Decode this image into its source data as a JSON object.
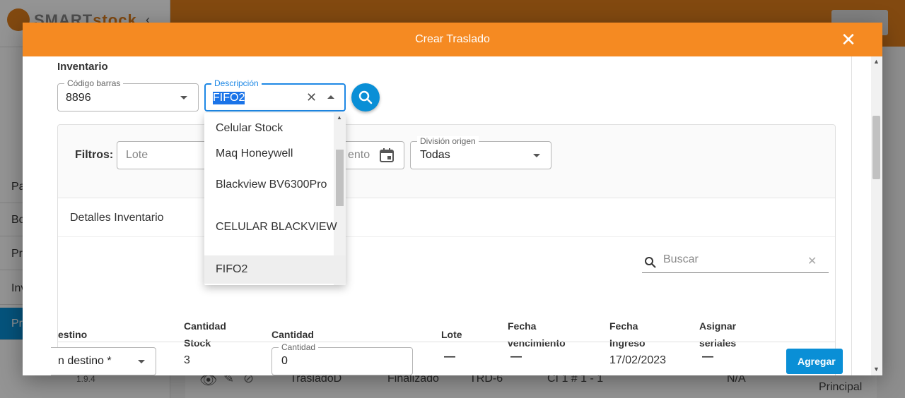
{
  "app": {
    "logo_prefix": "SMART",
    "logo_suffix": "stock",
    "version": "1.9.4",
    "sidebar_items": [
      "Pa",
      "Bo",
      "Pr",
      "Inv",
      "Pr"
    ]
  },
  "background_row": {
    "name": "TrasladoD",
    "status": "Finalizado",
    "code": "TRD-6",
    "location": "CI 1 # 1 - 1",
    "na": "N/A",
    "principal": "Principal"
  },
  "modal": {
    "title": "Crear Traslado",
    "section_title": "Inventario",
    "codigo_barras": {
      "label": "Código barras",
      "value": "8896"
    },
    "descripcion": {
      "label": "Descripción",
      "value": "FIFO2"
    },
    "dropdown_options": [
      "Celular Stock",
      "Maq Honeywell",
      "Blackview BV6300Pro",
      "CELULAR BLACKVIEW",
      "FIFO2"
    ],
    "dropdown_selected": "FIFO2",
    "filters": {
      "label": "Filtros:",
      "lote_placeholder": "Lote",
      "vencimiento_partial": "ento",
      "division": {
        "label": "División origen",
        "value": "Todas"
      }
    },
    "details": {
      "title": "Detalles Inventario",
      "search_placeholder": "Buscar",
      "columns": {
        "destino": "estino",
        "cantidad_stock_1": "Cantidad",
        "cantidad_stock_2": "Stock",
        "cantidad": "Cantidad",
        "lote": "Lote",
        "fecha_venc_1": "Fecha",
        "fecha_venc_2": "vencimiento",
        "fecha_ing_1": "Fecha",
        "fecha_ing_2": "Ingreso",
        "asignar_1": "Asignar",
        "asignar_2": "seriales"
      },
      "row": {
        "destino_value": "n destino *",
        "stock": "3",
        "cantidad_label": "Cantidad",
        "cantidad_value": "0",
        "lote": "—",
        "fecha_vencimiento": "—",
        "fecha_ingreso": "17/02/2023",
        "seriales": "—",
        "add_label": "Agregar"
      }
    }
  }
}
